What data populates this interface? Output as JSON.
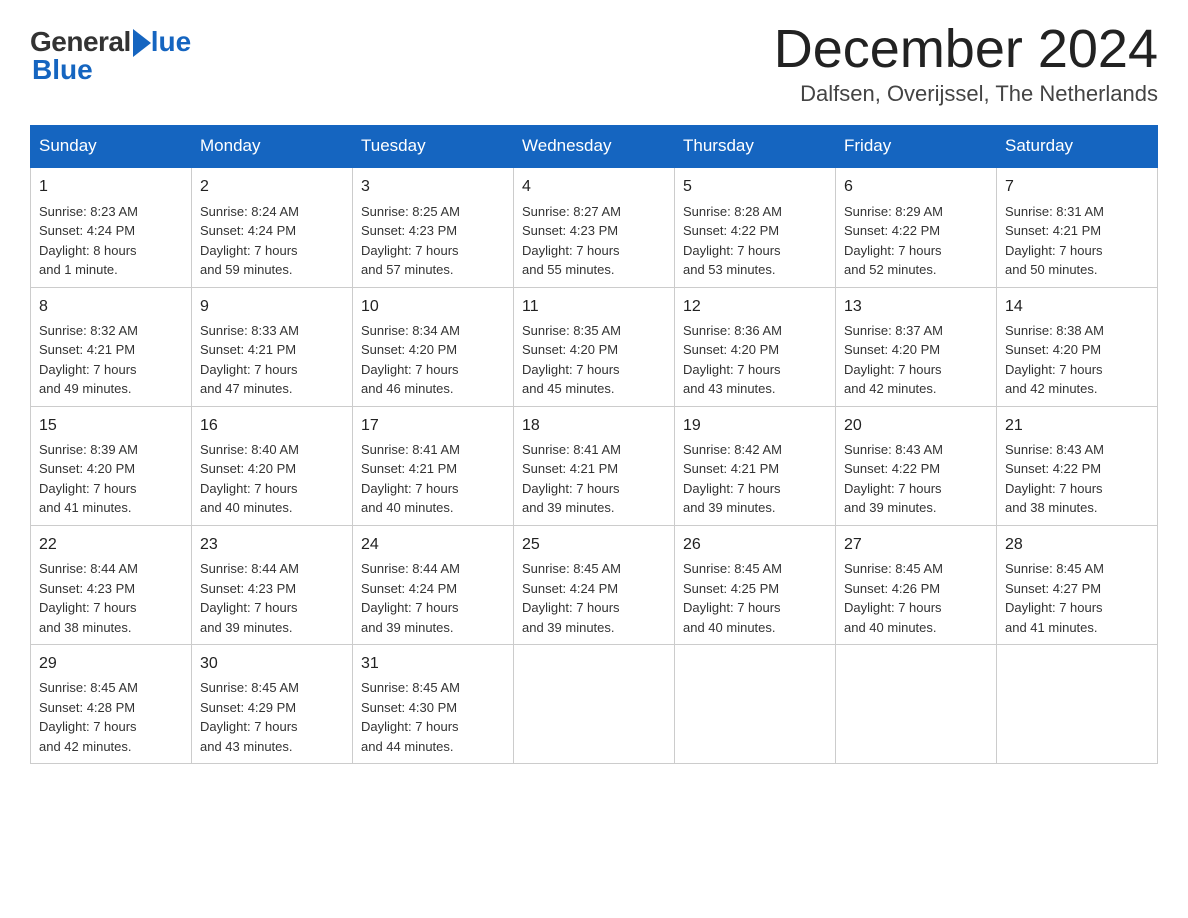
{
  "header": {
    "logo_general": "General",
    "logo_blue": "Blue",
    "month_title": "December 2024",
    "location": "Dalfsen, Overijssel, The Netherlands"
  },
  "days_of_week": [
    "Sunday",
    "Monday",
    "Tuesday",
    "Wednesday",
    "Thursday",
    "Friday",
    "Saturday"
  ],
  "weeks": [
    [
      {
        "day": "1",
        "sunrise": "Sunrise: 8:23 AM",
        "sunset": "Sunset: 4:24 PM",
        "daylight": "Daylight: 8 hours",
        "daylight2": "and 1 minute."
      },
      {
        "day": "2",
        "sunrise": "Sunrise: 8:24 AM",
        "sunset": "Sunset: 4:24 PM",
        "daylight": "Daylight: 7 hours",
        "daylight2": "and 59 minutes."
      },
      {
        "day": "3",
        "sunrise": "Sunrise: 8:25 AM",
        "sunset": "Sunset: 4:23 PM",
        "daylight": "Daylight: 7 hours",
        "daylight2": "and 57 minutes."
      },
      {
        "day": "4",
        "sunrise": "Sunrise: 8:27 AM",
        "sunset": "Sunset: 4:23 PM",
        "daylight": "Daylight: 7 hours",
        "daylight2": "and 55 minutes."
      },
      {
        "day": "5",
        "sunrise": "Sunrise: 8:28 AM",
        "sunset": "Sunset: 4:22 PM",
        "daylight": "Daylight: 7 hours",
        "daylight2": "and 53 minutes."
      },
      {
        "day": "6",
        "sunrise": "Sunrise: 8:29 AM",
        "sunset": "Sunset: 4:22 PM",
        "daylight": "Daylight: 7 hours",
        "daylight2": "and 52 minutes."
      },
      {
        "day": "7",
        "sunrise": "Sunrise: 8:31 AM",
        "sunset": "Sunset: 4:21 PM",
        "daylight": "Daylight: 7 hours",
        "daylight2": "and 50 minutes."
      }
    ],
    [
      {
        "day": "8",
        "sunrise": "Sunrise: 8:32 AM",
        "sunset": "Sunset: 4:21 PM",
        "daylight": "Daylight: 7 hours",
        "daylight2": "and 49 minutes."
      },
      {
        "day": "9",
        "sunrise": "Sunrise: 8:33 AM",
        "sunset": "Sunset: 4:21 PM",
        "daylight": "Daylight: 7 hours",
        "daylight2": "and 47 minutes."
      },
      {
        "day": "10",
        "sunrise": "Sunrise: 8:34 AM",
        "sunset": "Sunset: 4:20 PM",
        "daylight": "Daylight: 7 hours",
        "daylight2": "and 46 minutes."
      },
      {
        "day": "11",
        "sunrise": "Sunrise: 8:35 AM",
        "sunset": "Sunset: 4:20 PM",
        "daylight": "Daylight: 7 hours",
        "daylight2": "and 45 minutes."
      },
      {
        "day": "12",
        "sunrise": "Sunrise: 8:36 AM",
        "sunset": "Sunset: 4:20 PM",
        "daylight": "Daylight: 7 hours",
        "daylight2": "and 43 minutes."
      },
      {
        "day": "13",
        "sunrise": "Sunrise: 8:37 AM",
        "sunset": "Sunset: 4:20 PM",
        "daylight": "Daylight: 7 hours",
        "daylight2": "and 42 minutes."
      },
      {
        "day": "14",
        "sunrise": "Sunrise: 8:38 AM",
        "sunset": "Sunset: 4:20 PM",
        "daylight": "Daylight: 7 hours",
        "daylight2": "and 42 minutes."
      }
    ],
    [
      {
        "day": "15",
        "sunrise": "Sunrise: 8:39 AM",
        "sunset": "Sunset: 4:20 PM",
        "daylight": "Daylight: 7 hours",
        "daylight2": "and 41 minutes."
      },
      {
        "day": "16",
        "sunrise": "Sunrise: 8:40 AM",
        "sunset": "Sunset: 4:20 PM",
        "daylight": "Daylight: 7 hours",
        "daylight2": "and 40 minutes."
      },
      {
        "day": "17",
        "sunrise": "Sunrise: 8:41 AM",
        "sunset": "Sunset: 4:21 PM",
        "daylight": "Daylight: 7 hours",
        "daylight2": "and 40 minutes."
      },
      {
        "day": "18",
        "sunrise": "Sunrise: 8:41 AM",
        "sunset": "Sunset: 4:21 PM",
        "daylight": "Daylight: 7 hours",
        "daylight2": "and 39 minutes."
      },
      {
        "day": "19",
        "sunrise": "Sunrise: 8:42 AM",
        "sunset": "Sunset: 4:21 PM",
        "daylight": "Daylight: 7 hours",
        "daylight2": "and 39 minutes."
      },
      {
        "day": "20",
        "sunrise": "Sunrise: 8:43 AM",
        "sunset": "Sunset: 4:22 PM",
        "daylight": "Daylight: 7 hours",
        "daylight2": "and 39 minutes."
      },
      {
        "day": "21",
        "sunrise": "Sunrise: 8:43 AM",
        "sunset": "Sunset: 4:22 PM",
        "daylight": "Daylight: 7 hours",
        "daylight2": "and 38 minutes."
      }
    ],
    [
      {
        "day": "22",
        "sunrise": "Sunrise: 8:44 AM",
        "sunset": "Sunset: 4:23 PM",
        "daylight": "Daylight: 7 hours",
        "daylight2": "and 38 minutes."
      },
      {
        "day": "23",
        "sunrise": "Sunrise: 8:44 AM",
        "sunset": "Sunset: 4:23 PM",
        "daylight": "Daylight: 7 hours",
        "daylight2": "and 39 minutes."
      },
      {
        "day": "24",
        "sunrise": "Sunrise: 8:44 AM",
        "sunset": "Sunset: 4:24 PM",
        "daylight": "Daylight: 7 hours",
        "daylight2": "and 39 minutes."
      },
      {
        "day": "25",
        "sunrise": "Sunrise: 8:45 AM",
        "sunset": "Sunset: 4:24 PM",
        "daylight": "Daylight: 7 hours",
        "daylight2": "and 39 minutes."
      },
      {
        "day": "26",
        "sunrise": "Sunrise: 8:45 AM",
        "sunset": "Sunset: 4:25 PM",
        "daylight": "Daylight: 7 hours",
        "daylight2": "and 40 minutes."
      },
      {
        "day": "27",
        "sunrise": "Sunrise: 8:45 AM",
        "sunset": "Sunset: 4:26 PM",
        "daylight": "Daylight: 7 hours",
        "daylight2": "and 40 minutes."
      },
      {
        "day": "28",
        "sunrise": "Sunrise: 8:45 AM",
        "sunset": "Sunset: 4:27 PM",
        "daylight": "Daylight: 7 hours",
        "daylight2": "and 41 minutes."
      }
    ],
    [
      {
        "day": "29",
        "sunrise": "Sunrise: 8:45 AM",
        "sunset": "Sunset: 4:28 PM",
        "daylight": "Daylight: 7 hours",
        "daylight2": "and 42 minutes."
      },
      {
        "day": "30",
        "sunrise": "Sunrise: 8:45 AM",
        "sunset": "Sunset: 4:29 PM",
        "daylight": "Daylight: 7 hours",
        "daylight2": "and 43 minutes."
      },
      {
        "day": "31",
        "sunrise": "Sunrise: 8:45 AM",
        "sunset": "Sunset: 4:30 PM",
        "daylight": "Daylight: 7 hours",
        "daylight2": "and 44 minutes."
      },
      null,
      null,
      null,
      null
    ]
  ]
}
